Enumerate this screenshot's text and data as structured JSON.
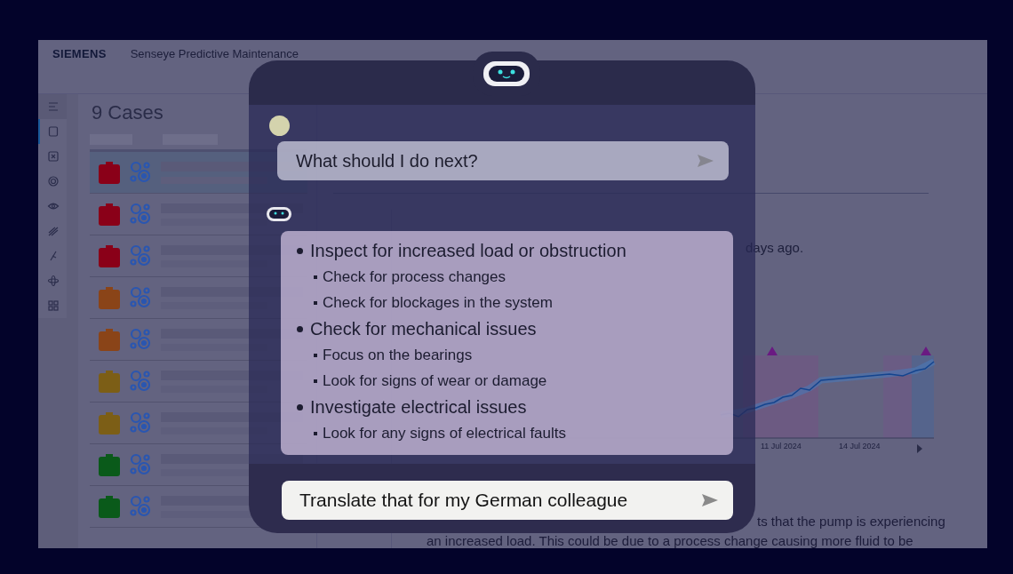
{
  "header": {
    "brand": "SIEMENS",
    "title": "Senseye Predictive Maintenance"
  },
  "sidebar": {
    "items": [
      {
        "kind": "menu",
        "selected": false
      },
      {
        "kind": "case",
        "selected": true
      },
      {
        "kind": "close",
        "selected": false
      },
      {
        "kind": "target",
        "selected": false
      },
      {
        "kind": "eye",
        "selected": false
      },
      {
        "kind": "trend",
        "selected": false
      },
      {
        "kind": "tool",
        "selected": false
      },
      {
        "kind": "atom",
        "selected": false
      },
      {
        "kind": "grid",
        "selected": false
      }
    ]
  },
  "cases": {
    "title": "9 Cases",
    "rows": [
      {
        "color": "#8a0018",
        "selected": true
      },
      {
        "color": "#8a0018",
        "selected": false
      },
      {
        "color": "#8a0018",
        "selected": false
      },
      {
        "color": "#8a4418",
        "selected": false
      },
      {
        "color": "#8a4418",
        "selected": false
      },
      {
        "color": "#7c5e16",
        "selected": false
      },
      {
        "color": "#7c5e16",
        "selected": false
      },
      {
        "color": "#0a5a1a",
        "selected": false
      },
      {
        "color": "#0a5a1a",
        "selected": false
      }
    ]
  },
  "case_detail": {
    "trend_text": "days ago.",
    "chart": {
      "tick_labels": [
        "11 Jul 2024",
        "14 Jul 2024"
      ]
    },
    "explanation": [
      "ts that the pump is experiencing",
      "an increased load. This could be due to a process change causing more fluid to be"
    ]
  },
  "assistant": {
    "question": "What should I do next?",
    "answer": [
      {
        "text": "Inspect for increased load or obstruction",
        "children": [
          {
            "text": "Check for process changes"
          },
          {
            "text": "Check for blockages in the system"
          }
        ]
      },
      {
        "text": "Check for mechanical issues",
        "children": [
          {
            "text": "Focus on the bearings"
          },
          {
            "text": "Look for signs of wear or damage"
          }
        ]
      },
      {
        "text": "Investigate electrical issues",
        "children": [
          {
            "text": "Look for any signs of electrical faults"
          }
        ]
      }
    ],
    "input": {
      "value": "Translate that for my German colleague"
    }
  }
}
